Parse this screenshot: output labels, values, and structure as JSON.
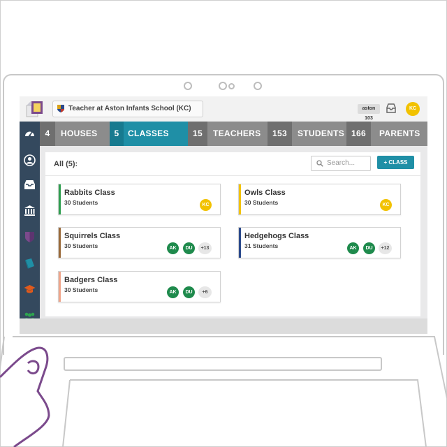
{
  "topbar": {
    "school": "Teacher at Aston Infants School (KC)",
    "user_code": "aston 103",
    "avatar": "KC",
    "colors": {
      "avatar": "#f2c200"
    }
  },
  "nav": {
    "tabs": [
      {
        "count": "4",
        "label": "HOUSES",
        "active": false
      },
      {
        "count": "5",
        "label": "CLASSES",
        "active": true
      },
      {
        "count": "15",
        "label": "TEACHERS",
        "active": false
      },
      {
        "count": "153",
        "label": "STUDENTS",
        "active": false
      },
      {
        "count": "166",
        "label": "PARENTS",
        "active": false
      }
    ],
    "colors": {
      "active": "#1f8fa6",
      "active_count": "#177a8f",
      "count": "#6f6f6f",
      "base": "#8c8c8c"
    }
  },
  "sidebar": {
    "icons": [
      "dashboard-icon",
      "user-icon",
      "inbox-icon",
      "school-building-icon",
      "shield-icon",
      "book-icon",
      "graduation-cap-icon",
      "group-icon"
    ]
  },
  "main": {
    "all_label": "All (5):",
    "search_placeholder": "Search...",
    "add_button": "+ CLASS",
    "classes": [
      {
        "name": "Rabbits Class",
        "students": "30 Students",
        "color": "#2e9e4f",
        "avatars": [
          {
            "initials": "KC",
            "color": "#f2c200"
          }
        ],
        "more": ""
      },
      {
        "name": "Owls Class",
        "students": "30 Students",
        "color": "#f2c200",
        "avatars": [
          {
            "initials": "KC",
            "color": "#f2c200"
          }
        ],
        "more": ""
      },
      {
        "name": "Squirrels Class",
        "students": "30 Students",
        "color": "#9a6a3a",
        "avatars": [
          {
            "initials": "AK",
            "color": "#1e8a4c"
          },
          {
            "initials": "DU",
            "color": "#1e8a4c"
          }
        ],
        "more": "+13"
      },
      {
        "name": "Hedgehogs Class",
        "students": "31 Students",
        "color": "#2b4a8c",
        "avatars": [
          {
            "initials": "AK",
            "color": "#1e8a4c"
          },
          {
            "initials": "DU",
            "color": "#1e8a4c"
          }
        ],
        "more": "+12"
      },
      {
        "name": "Badgers Class",
        "students": "30 Students",
        "color": "#f0a58a",
        "avatars": [
          {
            "initials": "AK",
            "color": "#1e8a4c"
          },
          {
            "initials": "DU",
            "color": "#1e8a4c"
          }
        ],
        "more": "+6"
      }
    ]
  }
}
